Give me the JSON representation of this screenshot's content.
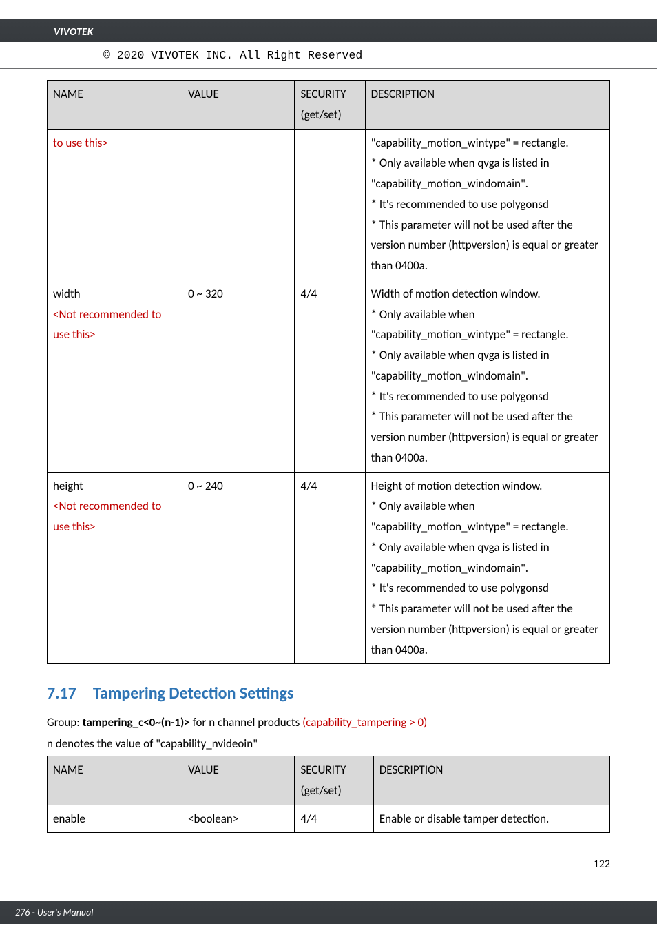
{
  "brand": "VIVOTEK",
  "copyright": "© 2020 VIVOTEK INC. All Right Reserved",
  "table1": {
    "headers": {
      "name": "NAME",
      "value": "VALUE",
      "security": "SECURITY (get/set)",
      "description": "DESCRIPTION"
    },
    "rows": [
      {
        "name_note": "to use this>",
        "value": "",
        "security": "",
        "desc": "\"capability_motion_wintype\" = rectangle.\n* Only available when qvga is listed in \"capability_motion_windomain\".\n* It's recommended to use polygonsd\n* This parameter will not be used after the version number (httpversion) is equal or greater than 0400a."
      },
      {
        "name": "width",
        "name_note": "<Not recommended to use this>",
        "value": "0 ~ 320",
        "security": "4/4",
        "desc": "Width of motion detection window.\n* Only available when \"capability_motion_wintype\" = rectangle.\n* Only available when qvga is listed in \"capability_motion_windomain\".\n* It's recommended to use polygonsd\n* This parameter will not be used after the version number (httpversion) is equal or greater than 0400a."
      },
      {
        "name": "height",
        "name_note": "<Not recommended to use this>",
        "value": "0 ~ 240",
        "security": "4/4",
        "desc": "Height of motion detection window.\n* Only available when \"capability_motion_wintype\" = rectangle.\n* Only available when qvga is listed in \"capability_motion_windomain\".\n* It's recommended to use polygonsd\n* This parameter will not be used after the version number (httpversion) is equal or greater than 0400a."
      }
    ]
  },
  "section": {
    "number": "7.17",
    "title": "Tampering Detection Settings",
    "group_prefix": "Group: ",
    "group_bold": "tampering_c<0~(n-1)>",
    "group_mid": " for n channel products ",
    "group_red": "(capability_tampering > 0)",
    "note": "n denotes the value of \"capability_nvideoin\""
  },
  "table2": {
    "headers": {
      "name": "NAME",
      "value": "VALUE",
      "security": "SECURITY (get/set)",
      "description": "DESCRIPTION"
    },
    "rows": [
      {
        "name": "enable",
        "value": "<boolean>",
        "security": "4/4",
        "desc": "Enable or disable tamper detection."
      }
    ]
  },
  "footer": {
    "manual": "276 - User's Manual",
    "page": "122"
  }
}
